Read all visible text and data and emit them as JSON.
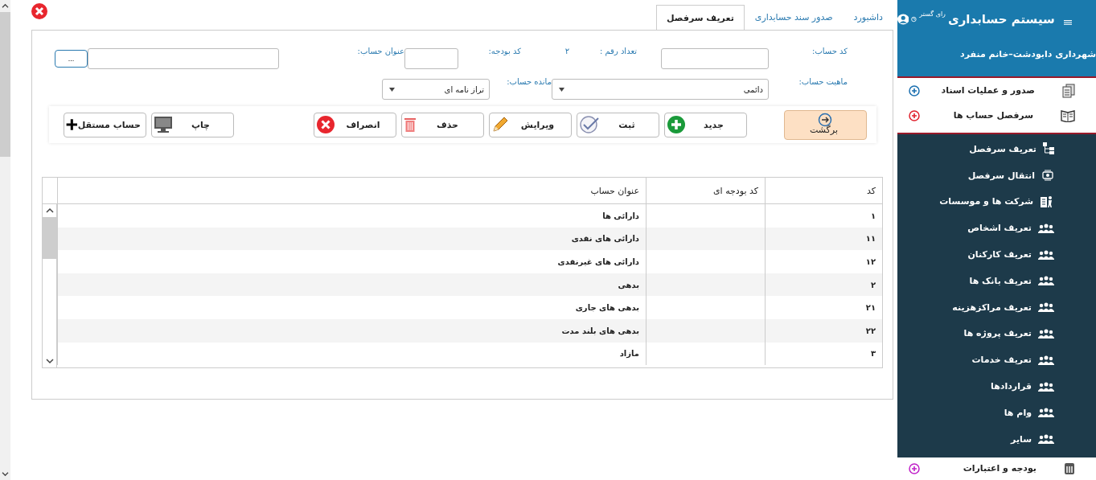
{
  "sidebar": {
    "title": "سیستم حسابداری",
    "brand": "رای گستر",
    "org": "شهرداری دابودشت–خانم منفرد",
    "sections": [
      {
        "label": "صدور و عملیات اسناد",
        "kind": "documents",
        "color": "#1a6fb0"
      },
      {
        "label": "سرفصل حساب ها",
        "kind": "book",
        "color": "#e0202c",
        "children": [
          {
            "label": "تعریف سرفصل",
            "kind": "tree"
          },
          {
            "label": "انتقال سرفصل",
            "kind": "transfer"
          },
          {
            "label": "شرکت ها و موسسات",
            "kind": "company"
          },
          {
            "label": "تعریف اشخاص",
            "kind": "people"
          },
          {
            "label": "تعریف کارکنان",
            "kind": "people"
          },
          {
            "label": "تعریف بانک ها",
            "kind": "people"
          },
          {
            "label": "تعریف مراکزهزینه",
            "kind": "people"
          },
          {
            "label": "تعریف پروژه ها",
            "kind": "people"
          },
          {
            "label": "تعریف خدمات",
            "kind": "people"
          },
          {
            "label": "قراردادها",
            "kind": "people"
          },
          {
            "label": "وام ها",
            "kind": "people"
          },
          {
            "label": "سایر",
            "kind": "people"
          }
        ]
      },
      {
        "label": "بودجه و اعتبارات",
        "kind": "calculator",
        "color": "#c020c8"
      }
    ]
  },
  "tabs": [
    {
      "label": "داشبورد",
      "selected": false
    },
    {
      "label": "صدور سند حسابداری",
      "selected": false
    },
    {
      "label": "تعریف سرفصل",
      "selected": true
    }
  ],
  "form": {
    "account_code": {
      "label": "کد حساب:"
    },
    "digit_count": {
      "label": "تعداد رقم :",
      "value": "۲"
    },
    "budget_code": {
      "label": "کد بودجه:"
    },
    "account_title": {
      "label": "عنوان حساب:"
    },
    "browse_button": "...",
    "account_nature": {
      "label": "ماهیت حساب:",
      "value": "دائمی"
    },
    "account_balance": {
      "label": "مانده حساب:",
      "value": "تراز نامه ای"
    }
  },
  "actions": [
    {
      "label": "برگشت",
      "kind": "back"
    },
    {
      "label": "جدید",
      "kind": "new"
    },
    {
      "label": "ثبت",
      "kind": "save"
    },
    {
      "label": "ویرایش",
      "kind": "edit"
    },
    {
      "label": "حذف",
      "kind": "delete"
    },
    {
      "label": "انصراف",
      "kind": "cancel"
    }
  ],
  "extra_actions": [
    {
      "label": "چاپ",
      "kind": "print"
    },
    {
      "label": "حساب مستقل",
      "kind": "add"
    }
  ],
  "table": {
    "columns": [
      "کد",
      "کد بودجه ای",
      "عنوان حساب"
    ],
    "rows": [
      {
        "code": "۱",
        "title": "دارائی ها"
      },
      {
        "code": "۱۱",
        "title": "دارائی های نقدی"
      },
      {
        "code": "۱۲",
        "title": "دارائی های غیرنقدی"
      },
      {
        "code": "۲",
        "title": "بدهی"
      },
      {
        "code": "۲۱",
        "title": "بدهی های جاری"
      },
      {
        "code": "۲۲",
        "title": "بدهی های بلند مدت"
      },
      {
        "code": "۳",
        "title": "مازاد"
      }
    ]
  }
}
